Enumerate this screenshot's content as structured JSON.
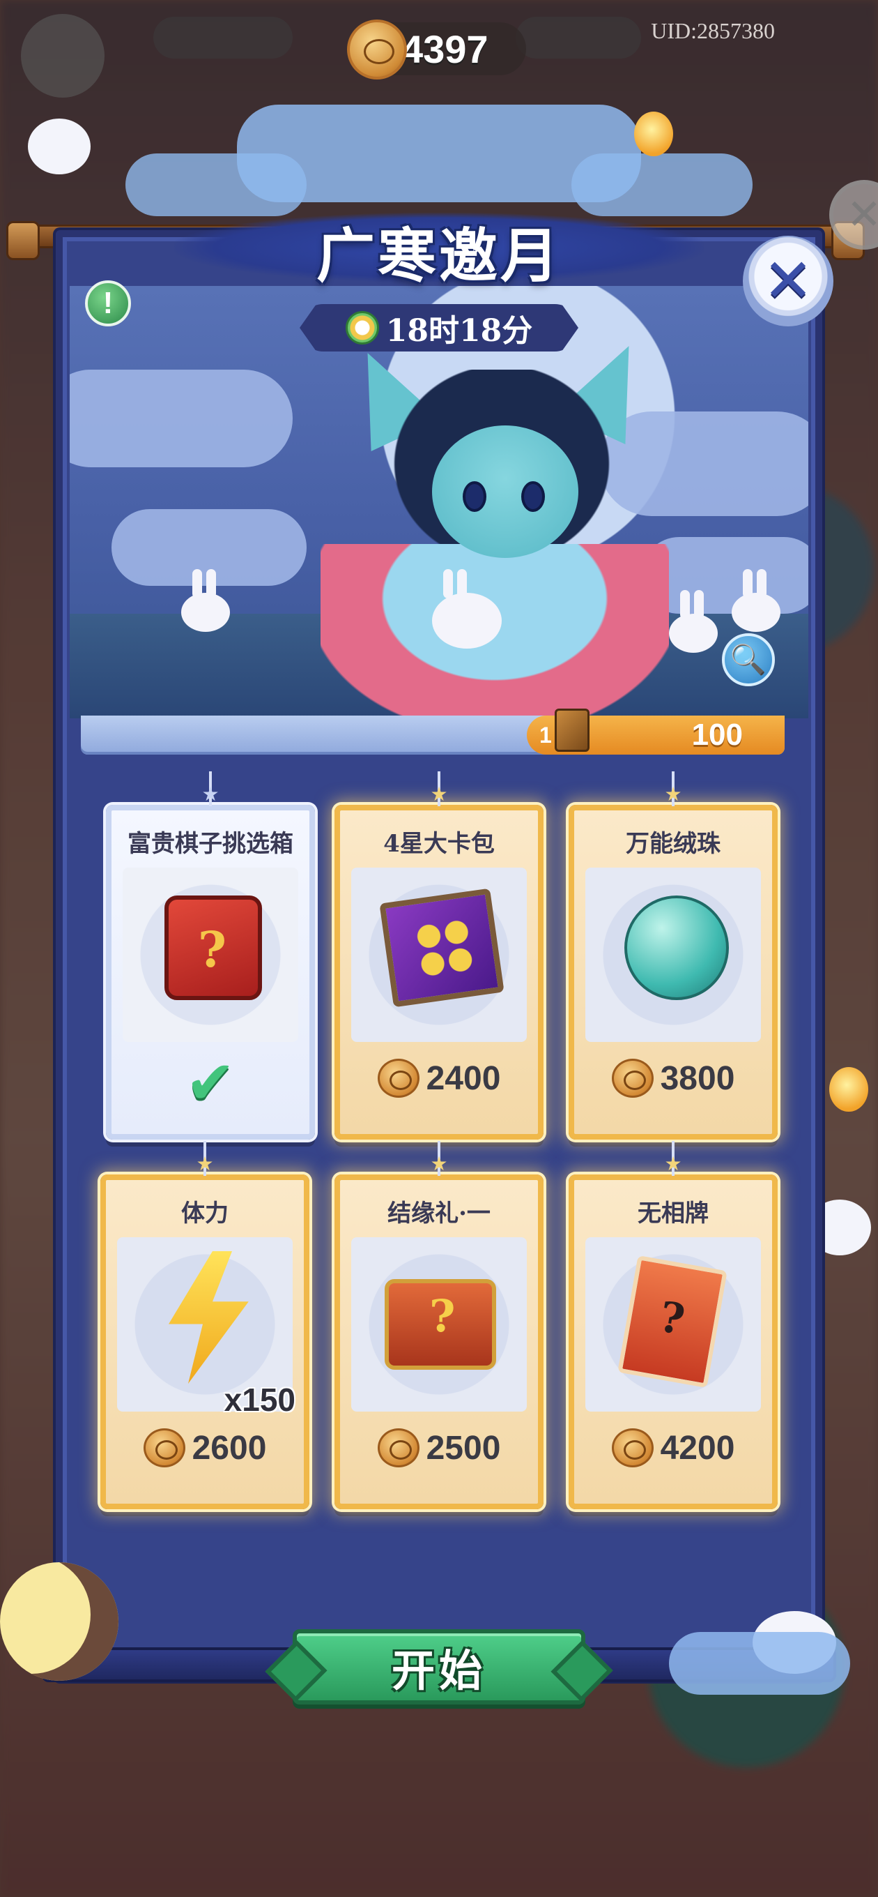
{
  "topbar": {
    "currency_value": "4397",
    "uid": "UID:2857380"
  },
  "event": {
    "title": "广寒邀月",
    "timer": "18时18分",
    "info_glyph": "!",
    "close_glyph": "✕",
    "magnify_glyph": "🔍"
  },
  "progress": {
    "partial_label": "1",
    "target_value": "100"
  },
  "cards": [
    {
      "name": "富贵棋子挑选箱",
      "selected": true,
      "icon": "red-box-icon"
    },
    {
      "name": "4星大卡包",
      "price": "2400",
      "icon": "card-pack-icon"
    },
    {
      "name": "万能绒珠",
      "price": "3800",
      "icon": "orb-icon"
    },
    {
      "name": "体力",
      "price": "2600",
      "quantity": "x150",
      "icon": "lightning-icon"
    },
    {
      "name": "结缘礼·一",
      "price": "2500",
      "icon": "treasure-chest-icon"
    },
    {
      "name": "无相牌",
      "price": "4200",
      "icon": "mystery-cards-icon"
    }
  ],
  "selected_glyph": "✔",
  "start_button": {
    "label": "开始"
  },
  "colors": {
    "panel": "#36448a",
    "card_border": "#f0b84a",
    "start_button": "#2a9a5c",
    "progress_orange": "#e58a22"
  }
}
